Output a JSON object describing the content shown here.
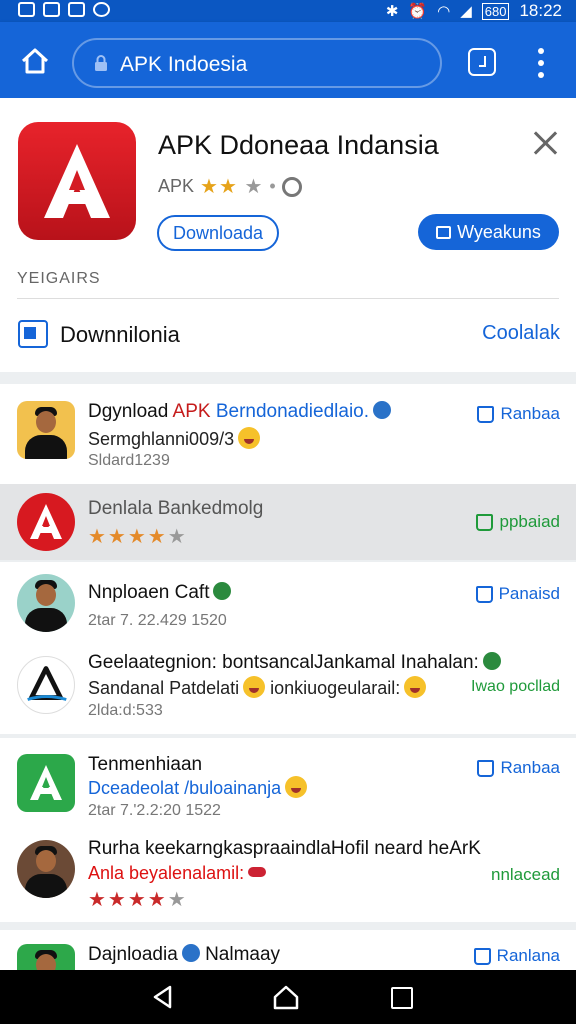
{
  "status_bar": {
    "time": "18:22",
    "battery": "680"
  },
  "browser": {
    "url": "APK Indoesia"
  },
  "header": {
    "app_title": "APK Ddoneaa Indansia",
    "rating_prefix": "APK",
    "stars_on": "★★",
    "stars_off": "★",
    "download_label": "Downloada",
    "primary_label": "Wyeakuns",
    "section_label": "YEIGAIRS",
    "download_row_label": "Downnilonia",
    "download_row_link": "Coolalak"
  },
  "list": [
    {
      "title_a": "Dgynload",
      "title_b": "APK",
      "title_c": "Berndonadiedlaio.",
      "sub": "Sermghlanni009/3",
      "meta": "Sldard1239",
      "action": "Ranbaa"
    },
    {
      "title": "Denlala Bankedmolg",
      "stars_on": "★★★★",
      "stars_off": "★",
      "action": "ppbaiad",
      "icon_text": "ie Ioi"
    },
    {
      "title": "Nnploaen Caft",
      "meta": "2tar 7. 22.429 1520",
      "action": "Panaisd"
    },
    {
      "title": "Geelaategnion: bontsancalJankamal Inahalan:",
      "sub": "Sandanal Patdelati",
      "sub_b": "ionkiuogeularail:",
      "meta": "2lda:d:533",
      "action": "Iwao pocllad"
    },
    {
      "title": "Tenmenhiaan",
      "sub": "Dceadeolat /buloainanja",
      "meta": "2tar 7.'2.2:20 1522",
      "action": "Ranbaa"
    },
    {
      "title": "Rurha keekarngkaspraaindlaHofil neard heArK",
      "sub": "Anla beyalenalamil:",
      "stars_on": "★★★★",
      "stars_off": "★",
      "action": "nnlacead"
    },
    {
      "title": "Dajnloadia",
      "title_b": "Nalmaay",
      "action": "Ranlana"
    }
  ],
  "colors": {
    "primary": "#1565d8",
    "brand_red": "#d71920",
    "accent_green": "#1f9a3a"
  }
}
